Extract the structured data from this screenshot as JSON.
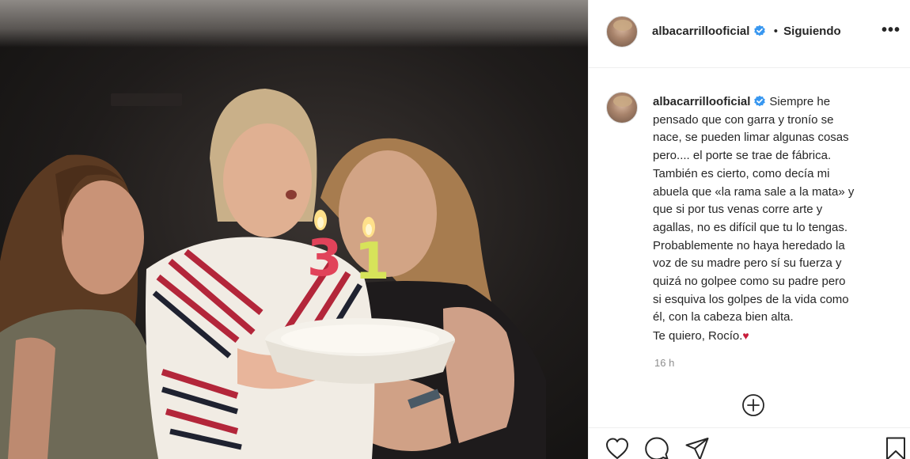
{
  "post": {
    "username": "albacarrillooficial",
    "follow_status": "Siguiendo",
    "more_glyph": "•••",
    "caption_lines": [
      "Siempre he",
      "pensado que con garra y tronío se",
      "nace, se pueden limar algunas cosas",
      "pero.... el porte se trae de fábrica.",
      "También es cierto, como decía mi",
      "abuela que «la rama sale a la mata» y",
      "que si por tus venas corre arte y",
      "agallas, no es difícil que tu lo tengas.",
      "Probablemente no haya heredado la",
      "voz de su madre pero sí su fuerza y",
      "quizá no golpee como su padre pero",
      "si esquiva los golpes de la vida como",
      "él, con la cabeza bien alta.",
      "Te quiero, Rocío."
    ],
    "caption_emoji": "♥",
    "timestamp": "16 h",
    "photo_candles": [
      "3",
      "1"
    ]
  },
  "icons": {
    "verified": "verified-badge-icon",
    "more": "more-options-icon",
    "add_comment": "plus-circle-icon",
    "like": "heart-icon",
    "comment": "comment-icon",
    "share": "send-icon",
    "save": "bookmark-icon"
  },
  "colors": {
    "verified_blue": "#3897f0",
    "heart_emoji": "#c81d3b",
    "muted_text": "#8e8e8e",
    "border": "#efefef"
  }
}
